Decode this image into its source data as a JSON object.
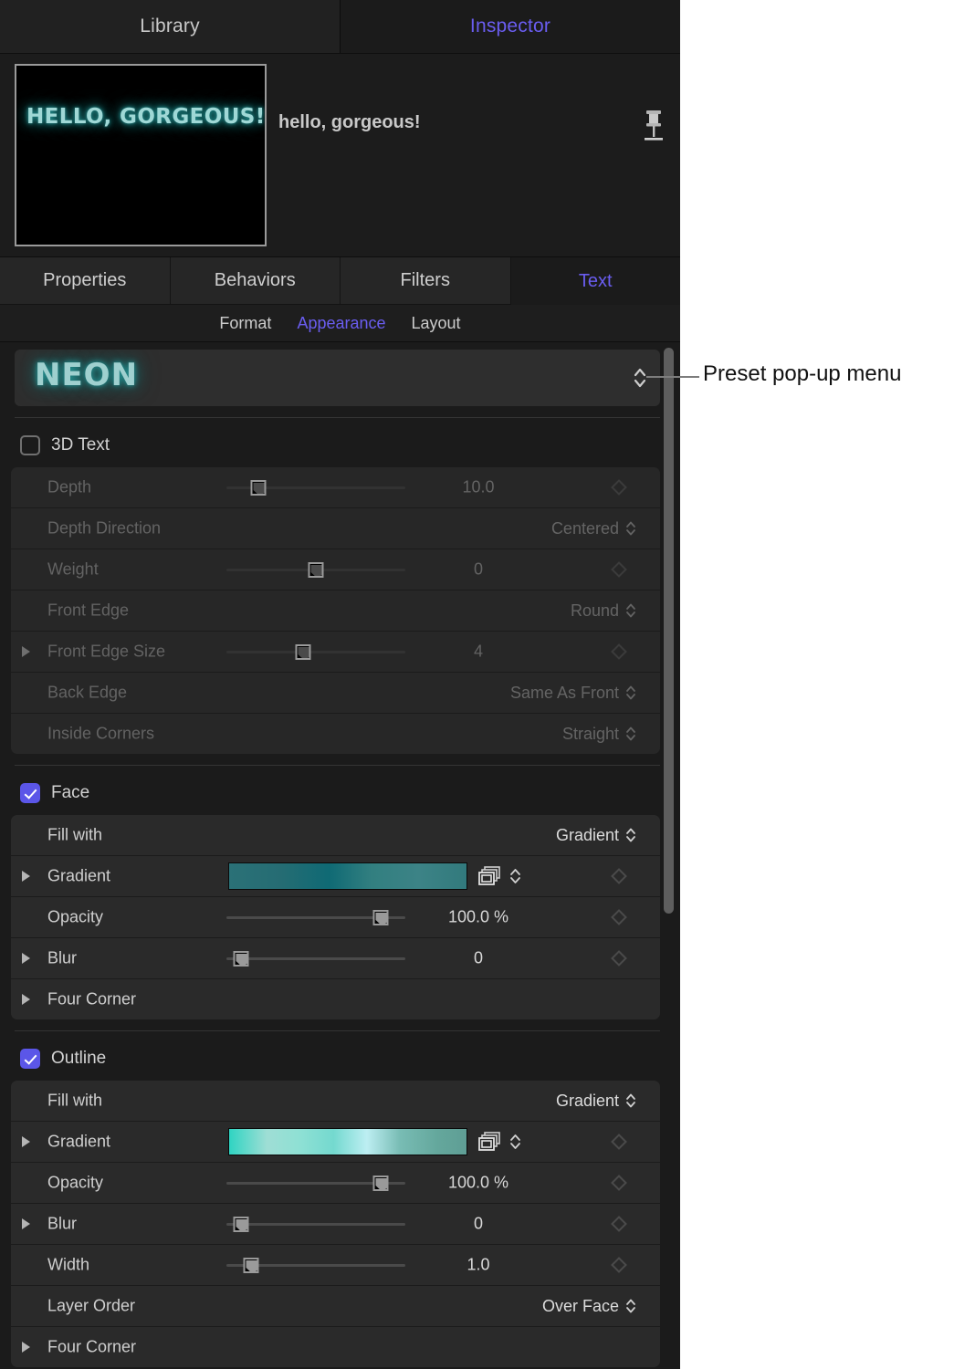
{
  "top_tabs": [
    {
      "label": "Library",
      "active": false
    },
    {
      "label": "Inspector",
      "active": true
    }
  ],
  "preview": {
    "thumbnail_text": "HELLO, GORGEOUS!",
    "object_title": "hello, gorgeous!",
    "pin_icon": "pin-icon"
  },
  "main_tabs": [
    {
      "label": "Properties",
      "active": false
    },
    {
      "label": "Behaviors",
      "active": false
    },
    {
      "label": "Filters",
      "active": false
    },
    {
      "label": "Text",
      "active": true
    }
  ],
  "sub_tabs": [
    {
      "label": "Format",
      "active": false
    },
    {
      "label": "Appearance",
      "active": true
    },
    {
      "label": "Layout",
      "active": false
    }
  ],
  "preset": {
    "name": "NEON",
    "stepper_icon": "up-down-chevron-icon"
  },
  "three_d": {
    "checkbox_label": "3D Text",
    "checked": false,
    "rows": [
      {
        "name": "Depth",
        "kind": "slider",
        "value": "10.0",
        "unit": "",
        "pos": 18,
        "disclosure": false,
        "keyframe": true
      },
      {
        "name": "Depth Direction",
        "kind": "popup",
        "value": "Centered",
        "disclosure": false,
        "keyframe": false
      },
      {
        "name": "Weight",
        "kind": "slider",
        "value": "0",
        "unit": "",
        "pos": 50,
        "disclosure": false,
        "keyframe": true
      },
      {
        "name": "Front Edge",
        "kind": "popup",
        "value": "Round",
        "disclosure": false,
        "keyframe": false
      },
      {
        "name": "Front Edge Size",
        "kind": "slider",
        "value": "4",
        "unit": "",
        "pos": 43,
        "disclosure": true,
        "keyframe": true
      },
      {
        "name": "Back Edge",
        "kind": "popup",
        "value": "Same As Front",
        "disclosure": false,
        "keyframe": false
      },
      {
        "name": "Inside Corners",
        "kind": "popup",
        "value": "Straight",
        "disclosure": false,
        "keyframe": false
      }
    ]
  },
  "face": {
    "checkbox_label": "Face",
    "checked": true,
    "rows": [
      {
        "name": "Fill with",
        "kind": "popup",
        "value": "Gradient",
        "disclosure": false,
        "keyframe": false
      },
      {
        "name": "Gradient",
        "kind": "gradient",
        "gradient": "face",
        "disclosure": true,
        "keyframe": true
      },
      {
        "name": "Opacity",
        "kind": "slider",
        "value": "100.0",
        "unit": "%",
        "pos": 86,
        "disclosure": false,
        "keyframe": true
      },
      {
        "name": "Blur",
        "kind": "slider",
        "value": "0",
        "unit": "",
        "pos": 8,
        "disclosure": true,
        "keyframe": true
      },
      {
        "name": "Four Corner",
        "kind": "plain",
        "disclosure": true,
        "keyframe": false
      }
    ]
  },
  "outline": {
    "checkbox_label": "Outline",
    "checked": true,
    "rows": [
      {
        "name": "Fill with",
        "kind": "popup",
        "value": "Gradient",
        "disclosure": false,
        "keyframe": false
      },
      {
        "name": "Gradient",
        "kind": "gradient",
        "gradient": "outline",
        "disclosure": true,
        "keyframe": true
      },
      {
        "name": "Opacity",
        "kind": "slider",
        "value": "100.0",
        "unit": "%",
        "pos": 86,
        "disclosure": false,
        "keyframe": true
      },
      {
        "name": "Blur",
        "kind": "slider",
        "value": "0",
        "unit": "",
        "pos": 8,
        "disclosure": true,
        "keyframe": true
      },
      {
        "name": "Width",
        "kind": "slider",
        "value": "1.0",
        "unit": "",
        "pos": 11,
        "disclosure": false,
        "keyframe": true
      },
      {
        "name": "Layer Order",
        "kind": "popup",
        "value": "Over Face",
        "disclosure": false,
        "keyframe": false
      },
      {
        "name": "Four Corner",
        "kind": "plain",
        "disclosure": true,
        "keyframe": false
      }
    ]
  },
  "gradients": {
    "face": "linear-gradient(90deg, #2b7177 0%, #256c73 22%, #0f6a74 42%, #327f80 60%, #3c8386 80%, #327a7d 100%)",
    "outline": "linear-gradient(90deg, #2fd4c2 0%, #9fded5 16%, #8ee0d4 30%, #74d9cf 44%, #bdeef2 58%, #78bcb4 72%, #64a79c 88%, #5f9e95 100%)"
  },
  "callout": {
    "label": "Preset pop-up menu",
    "accent": "#7d7d7d"
  },
  "colors": {
    "panel_bg": "#1b1b1b",
    "row_bg": "#2a2a2a",
    "accent_blue": "#6a5df0",
    "checkbox_on": "#5b56e8",
    "neon_teal": "#9fd0cf"
  }
}
